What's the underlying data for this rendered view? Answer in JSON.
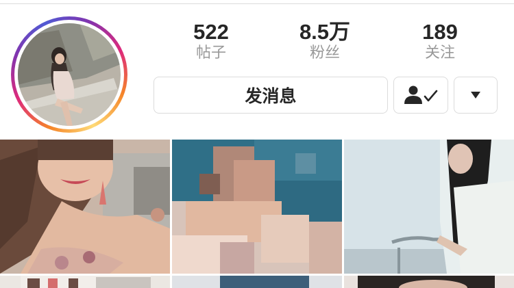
{
  "profile": {
    "stats": [
      {
        "value": "522",
        "label": "帖子"
      },
      {
        "value": "8.5万",
        "label": "粉丝"
      },
      {
        "value": "189",
        "label": "关注"
      }
    ],
    "actions": {
      "message_label": "发消息",
      "follow_icon": "person-check-icon",
      "more_icon": "caret-down-icon"
    },
    "accent_colors": [
      "#f58529",
      "#dd2a7b",
      "#8134af"
    ]
  },
  "grid": {
    "posts": [
      {
        "name": "post-1"
      },
      {
        "name": "post-2"
      },
      {
        "name": "post-3"
      },
      {
        "name": "post-4"
      },
      {
        "name": "post-5"
      },
      {
        "name": "post-6"
      }
    ]
  }
}
